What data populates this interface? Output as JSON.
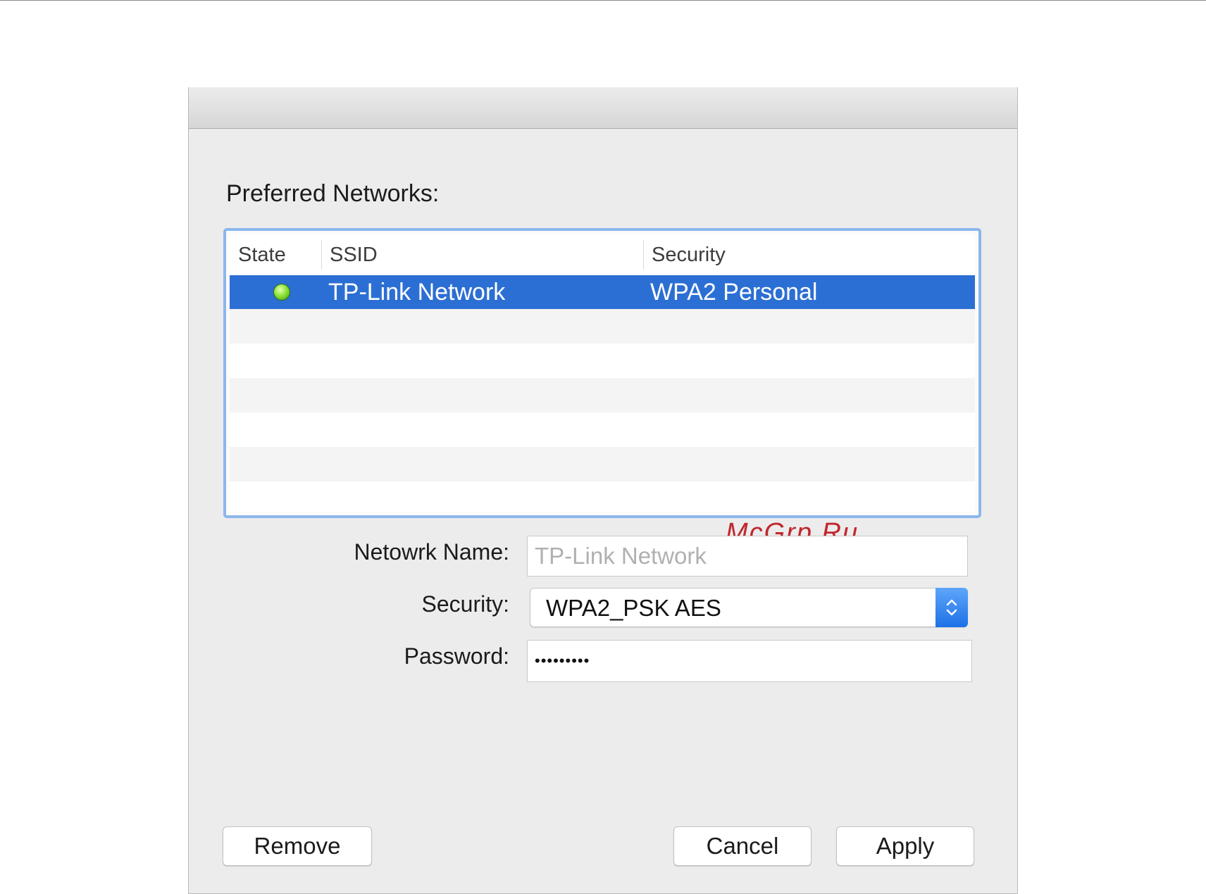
{
  "dialog": {
    "section_label": "Preferred Networks:"
  },
  "table": {
    "columns": [
      "State",
      "SSID",
      "Security"
    ],
    "rows": [
      {
        "state": "connected",
        "ssid": "TP-Link Network",
        "security": "WPA2 Personal",
        "selected": true
      }
    ]
  },
  "watermark": "McGrp.Ru",
  "form": {
    "name_label": "Netowrk Name:",
    "name_placeholder": "TP-Link Network",
    "security_label": "Security:",
    "security_value": "WPA2_PSK AES",
    "password_label": "Password:",
    "password_value": "•••••••••"
  },
  "buttons": {
    "remove": "Remove",
    "cancel": "Cancel",
    "apply": "Apply"
  },
  "colors": {
    "selection": "#2c6fd4",
    "focus_ring": "#8ab7ec",
    "state_connected": "#8ee43a",
    "watermark": "#c0272d"
  },
  "icons": {
    "state": "green-status-dot-icon",
    "select_stepper": "up-down-chevron-icon"
  }
}
